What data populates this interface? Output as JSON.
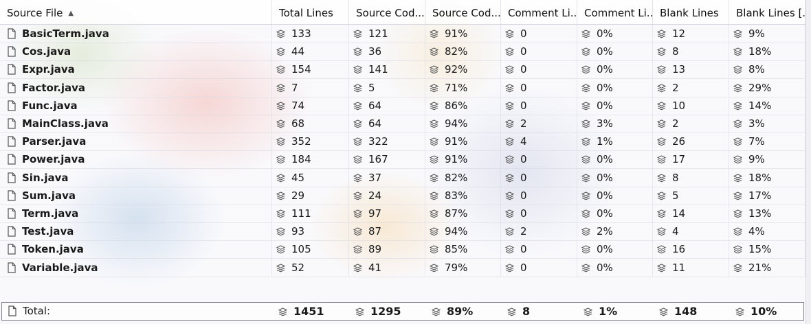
{
  "columns": [
    {
      "key": "file",
      "label": "Source File",
      "sorted": true
    },
    {
      "key": "total",
      "label": "Total Lines"
    },
    {
      "key": "source",
      "label": "Source Cod..."
    },
    {
      "key": "source_pct",
      "label": "Source Cod..."
    },
    {
      "key": "comment",
      "label": "Comment Li..."
    },
    {
      "key": "comment_pct",
      "label": "Comment Li..."
    },
    {
      "key": "blank",
      "label": "Blank Lines"
    },
    {
      "key": "blank_pct",
      "label": "Blank Lines [..."
    }
  ],
  "rows": [
    {
      "file": "BasicTerm.java",
      "total": "133",
      "source": "121",
      "source_pct": "91%",
      "comment": "0",
      "comment_pct": "0%",
      "blank": "12",
      "blank_pct": "9%"
    },
    {
      "file": "Cos.java",
      "total": "44",
      "source": "36",
      "source_pct": "82%",
      "comment": "0",
      "comment_pct": "0%",
      "blank": "8",
      "blank_pct": "18%"
    },
    {
      "file": "Expr.java",
      "total": "154",
      "source": "141",
      "source_pct": "92%",
      "comment": "0",
      "comment_pct": "0%",
      "blank": "13",
      "blank_pct": "8%"
    },
    {
      "file": "Factor.java",
      "total": "7",
      "source": "5",
      "source_pct": "71%",
      "comment": "0",
      "comment_pct": "0%",
      "blank": "2",
      "blank_pct": "29%"
    },
    {
      "file": "Func.java",
      "total": "74",
      "source": "64",
      "source_pct": "86%",
      "comment": "0",
      "comment_pct": "0%",
      "blank": "10",
      "blank_pct": "14%"
    },
    {
      "file": "MainClass.java",
      "total": "68",
      "source": "64",
      "source_pct": "94%",
      "comment": "2",
      "comment_pct": "3%",
      "blank": "2",
      "blank_pct": "3%"
    },
    {
      "file": "Parser.java",
      "total": "352",
      "source": "322",
      "source_pct": "91%",
      "comment": "4",
      "comment_pct": "1%",
      "blank": "26",
      "blank_pct": "7%"
    },
    {
      "file": "Power.java",
      "total": "184",
      "source": "167",
      "source_pct": "91%",
      "comment": "0",
      "comment_pct": "0%",
      "blank": "17",
      "blank_pct": "9%"
    },
    {
      "file": "Sin.java",
      "total": "45",
      "source": "37",
      "source_pct": "82%",
      "comment": "0",
      "comment_pct": "0%",
      "blank": "8",
      "blank_pct": "18%"
    },
    {
      "file": "Sum.java",
      "total": "29",
      "source": "24",
      "source_pct": "83%",
      "comment": "0",
      "comment_pct": "0%",
      "blank": "5",
      "blank_pct": "17%"
    },
    {
      "file": "Term.java",
      "total": "111",
      "source": "97",
      "source_pct": "87%",
      "comment": "0",
      "comment_pct": "0%",
      "blank": "14",
      "blank_pct": "13%"
    },
    {
      "file": "Test.java",
      "total": "93",
      "source": "87",
      "source_pct": "94%",
      "comment": "2",
      "comment_pct": "2%",
      "blank": "4",
      "blank_pct": "4%"
    },
    {
      "file": "Token.java",
      "total": "105",
      "source": "89",
      "source_pct": "85%",
      "comment": "0",
      "comment_pct": "0%",
      "blank": "16",
      "blank_pct": "15%"
    },
    {
      "file": "Variable.java",
      "total": "52",
      "source": "41",
      "source_pct": "79%",
      "comment": "0",
      "comment_pct": "0%",
      "blank": "11",
      "blank_pct": "21%"
    }
  ],
  "totals": {
    "file": "Total:",
    "total": "1451",
    "source": "1295",
    "source_pct": "89%",
    "comment": "8",
    "comment_pct": "1%",
    "blank": "148",
    "blank_pct": "10%"
  },
  "icons": {
    "file": "file-icon",
    "metric": "layers-icon",
    "sort": "sort-ascending-icon"
  },
  "colors": {
    "grid": "#d7d7e1",
    "footer_border": "#7f7f8a",
    "icon": "#555555"
  }
}
